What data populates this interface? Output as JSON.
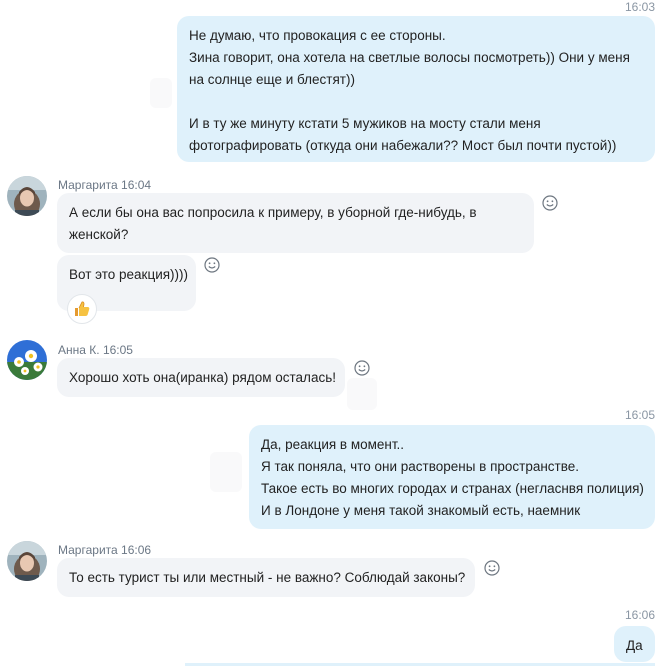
{
  "messages": [
    {
      "kind": "outgoing",
      "time": "16:03",
      "lines": [
        "Не думаю, что провокация с ее стороны.",
        "Зина говорит, она хотела на светлые волосы посмотреть)) Они у меня",
        "на солнце еще и блестят))",
        "",
        "И в ту же минуту кстати 5 мужиков на мосту стали меня",
        "фотографировать (откуда они набежали?? Мост был почти пустой))"
      ]
    },
    {
      "kind": "incoming",
      "sender": "Маргарита",
      "time": "16:04",
      "lines": [
        "А если бы она вас попросила к примеру, в уборной где-нибудь, в",
        "женской?"
      ]
    },
    {
      "kind": "incoming-cont",
      "lines": [
        "Вот это реакция))))"
      ],
      "reaction": "thumbs-up-icon"
    },
    {
      "kind": "incoming",
      "sender": "Анна К.",
      "time": "16:05",
      "lines": [
        "Хорошо хоть она(иранка) рядом осталась!"
      ]
    },
    {
      "kind": "outgoing",
      "time": "16:05",
      "lines": [
        "Да, реакция в момент..",
        "Я так поняла, что они растворены в пространстве.",
        "Такое есть во многих городах и странах (негласнвя полиция)",
        "И в Лондоне у меня такой знакомый есть, наемник"
      ]
    },
    {
      "kind": "incoming",
      "sender": "Маргарита",
      "time": "16:06",
      "lines": [
        "То есть турист ты или местный  - не важно? Соблюдай законы?"
      ]
    },
    {
      "kind": "outgoing",
      "time": "16:06",
      "lines": [
        "Да"
      ]
    }
  ],
  "colors": {
    "outgoing_bubble": "#dff1fb",
    "incoming_bubble": "#f2f4f7",
    "timestamp": "#8a96a3"
  }
}
